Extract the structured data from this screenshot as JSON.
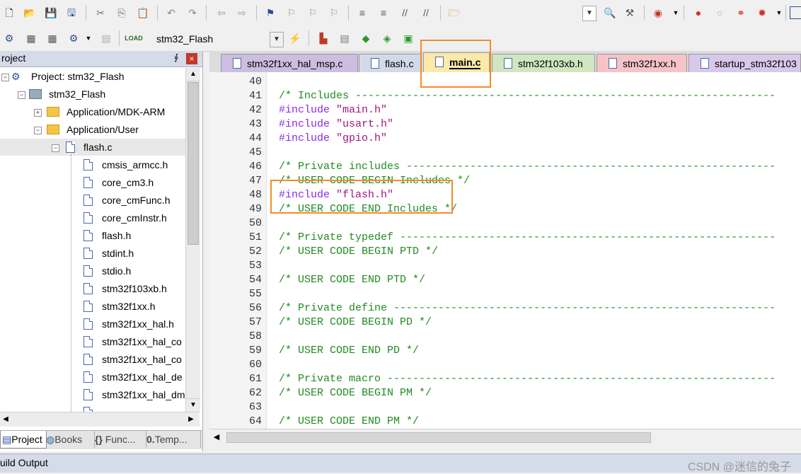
{
  "toolbar2": {
    "target_select": "stm32_Flash"
  },
  "project_panel": {
    "title": "roject",
    "pin_glyph": "⨕",
    "close_glyph": "×",
    "tree": [
      {
        "label": "Project: stm32_Flash",
        "icon": "project-icon",
        "level": 0
      },
      {
        "label": "stm32_Flash",
        "icon": "target-icon",
        "level": 1
      },
      {
        "label": "Application/MDK-ARM",
        "icon": "folder-icon",
        "level": 2
      },
      {
        "label": "Application/User",
        "icon": "folder-icon",
        "level": 2
      },
      {
        "label": "flash.c",
        "icon": "file-icon",
        "level": 3
      },
      {
        "label": "cmsis_armcc.h",
        "icon": "file-icon",
        "level": 4
      },
      {
        "label": "core_cm3.h",
        "icon": "file-icon",
        "level": 4
      },
      {
        "label": "core_cmFunc.h",
        "icon": "file-icon",
        "level": 4
      },
      {
        "label": "core_cmInstr.h",
        "icon": "file-icon",
        "level": 4
      },
      {
        "label": "flash.h",
        "icon": "file-icon",
        "level": 4
      },
      {
        "label": "stdint.h",
        "icon": "file-icon",
        "level": 4
      },
      {
        "label": "stdio.h",
        "icon": "file-icon",
        "level": 4
      },
      {
        "label": "stm32f103xb.h",
        "icon": "file-icon",
        "level": 4
      },
      {
        "label": "stm32f1xx.h",
        "icon": "file-icon",
        "level": 4
      },
      {
        "label": "stm32f1xx_hal.h",
        "icon": "file-icon",
        "level": 4
      },
      {
        "label": "stm32f1xx_hal_co",
        "icon": "file-icon",
        "level": 4
      },
      {
        "label": "stm32f1xx_hal_co",
        "icon": "file-icon",
        "level": 4
      },
      {
        "label": "stm32f1xx_hal_de",
        "icon": "file-icon",
        "level": 4
      },
      {
        "label": "stm32f1xx_hal_dm",
        "icon": "file-icon",
        "level": 4
      }
    ],
    "tabs": [
      {
        "label": "Project",
        "active": true
      },
      {
        "label": "Books",
        "active": false
      },
      {
        "label": "Func...",
        "active": false
      },
      {
        "label": "Temp...",
        "active": false
      }
    ]
  },
  "editor": {
    "tabs": [
      {
        "label": "stm32f1xx_hal_msp.c",
        "color": "#cdbde0",
        "active": false
      },
      {
        "label": "flash.c",
        "color": "#d2daea",
        "active": false
      },
      {
        "label": "main.c",
        "color": "#fde9a8",
        "active": true
      },
      {
        "label": "stm32f103xb.h",
        "color": "#cfe6c0",
        "active": false
      },
      {
        "label": "stm32f1xx.h",
        "color": "#f6c3c8",
        "active": false
      },
      {
        "label": "startup_stm32f103",
        "color": "#d8c8ea",
        "active": false
      }
    ],
    "lines": [
      {
        "n": "40",
        "parts": []
      },
      {
        "n": "41",
        "parts": [
          {
            "t": "/* Includes ------------------------------------------------------------------",
            "c": "cm"
          }
        ]
      },
      {
        "n": "42",
        "parts": [
          {
            "t": "#include ",
            "c": "pp"
          },
          {
            "t": "\"main.h\"",
            "c": "st"
          }
        ]
      },
      {
        "n": "43",
        "parts": [
          {
            "t": "#include ",
            "c": "pp"
          },
          {
            "t": "\"usart.h\"",
            "c": "st"
          }
        ]
      },
      {
        "n": "44",
        "parts": [
          {
            "t": "#include ",
            "c": "pp"
          },
          {
            "t": "\"gpio.h\"",
            "c": "st"
          }
        ]
      },
      {
        "n": "45",
        "parts": []
      },
      {
        "n": "46",
        "parts": [
          {
            "t": "/* Private includes ----------------------------------------------------------",
            "c": "cm"
          }
        ]
      },
      {
        "n": "47",
        "parts": [
          {
            "t": "/* USER CODE BEGIN Includes */",
            "c": "cm"
          }
        ]
      },
      {
        "n": "48",
        "parts": [
          {
            "t": "#include ",
            "c": "pp"
          },
          {
            "t": "\"flash.h\"",
            "c": "st"
          }
        ]
      },
      {
        "n": "49",
        "parts": [
          {
            "t": "/* USER CODE END Includes */",
            "c": "cm"
          }
        ]
      },
      {
        "n": "50",
        "parts": []
      },
      {
        "n": "51",
        "parts": [
          {
            "t": "/* Private typedef -----------------------------------------------------------",
            "c": "cm"
          }
        ]
      },
      {
        "n": "52",
        "parts": [
          {
            "t": "/* USER CODE BEGIN PTD */",
            "c": "cm"
          }
        ]
      },
      {
        "n": "53",
        "parts": []
      },
      {
        "n": "54",
        "parts": [
          {
            "t": "/* USER CODE END PTD */",
            "c": "cm"
          }
        ]
      },
      {
        "n": "55",
        "parts": []
      },
      {
        "n": "56",
        "parts": [
          {
            "t": "/* Private define ------------------------------------------------------------",
            "c": "cm"
          }
        ]
      },
      {
        "n": "57",
        "parts": [
          {
            "t": "/* USER CODE BEGIN PD */",
            "c": "cm"
          }
        ]
      },
      {
        "n": "58",
        "parts": []
      },
      {
        "n": "59",
        "parts": [
          {
            "t": "/* USER CODE END PD */",
            "c": "cm"
          }
        ]
      },
      {
        "n": "60",
        "parts": []
      },
      {
        "n": "61",
        "parts": [
          {
            "t": "/* Private macro -------------------------------------------------------------",
            "c": "cm"
          }
        ]
      },
      {
        "n": "62",
        "parts": [
          {
            "t": "/* USER CODE BEGIN PM */",
            "c": "cm"
          }
        ]
      },
      {
        "n": "63",
        "parts": []
      },
      {
        "n": "64",
        "parts": [
          {
            "t": "/* USER CODE END PM */",
            "c": "cm"
          }
        ]
      }
    ]
  },
  "build_output": {
    "title": "uild Output"
  },
  "watermark": "CSDN @迷信的兔子",
  "colors": {
    "highlight_box": "#f28c28",
    "comment": "#228b22",
    "preprocessor": "#8a2be2",
    "string": "#a0187a"
  }
}
